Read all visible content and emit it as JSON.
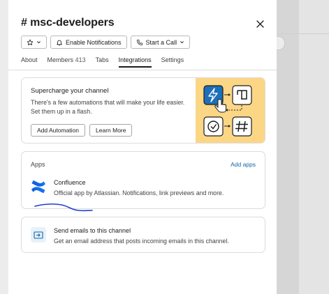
{
  "channel": {
    "title": "# msc-developers"
  },
  "header_buttons": {
    "star_icon": "star-icon",
    "notifications_label": "Enable Notifications",
    "call_label": "Start a Call"
  },
  "tabs": [
    {
      "label": "About"
    },
    {
      "label": "Members",
      "count": "413"
    },
    {
      "label": "Tabs"
    },
    {
      "label": "Integrations",
      "active": true
    },
    {
      "label": "Settings"
    }
  ],
  "automations_card": {
    "heading": "Supercharge your channel",
    "description": "There's a few automations that will make your life easier. Set them up in a flash.",
    "add_button": "Add Automation",
    "learn_button": "Learn More"
  },
  "apps_card": {
    "label": "Apps",
    "add_link": "Add apps",
    "apps": [
      {
        "name": "Confluence",
        "description": "Official app by Atlassian. Notifications, link previews and more."
      }
    ]
  },
  "email_card": {
    "title": "Send emails to this channel",
    "description": "Get an email address that posts incoming emails in this channel."
  },
  "colors": {
    "link": "#1264a3",
    "illustration_bg": "#fbd685",
    "lightning_tile": "#1d6fb8",
    "annotation_ink": "#1f3fd0"
  }
}
